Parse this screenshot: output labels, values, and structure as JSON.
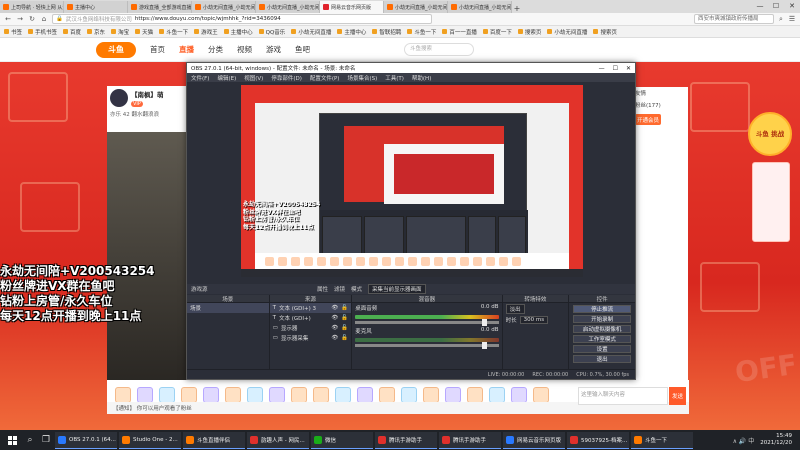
{
  "browser": {
    "tabs": [
      {
        "label": "上司导航 · 轻快上网 从这里开始",
        "active": false,
        "fav": "orange"
      },
      {
        "label": "主播中心",
        "active": false,
        "fav": "orange"
      },
      {
        "label": "游戏直播_全部游戏直播_斗鱼直播",
        "active": false,
        "fav": "orange"
      },
      {
        "label": "小劫无间直播_小劫无间视频直播",
        "active": false,
        "fav": "orange"
      },
      {
        "label": "小劫无间直播_小劫无间视频直播",
        "active": false,
        "fav": "orange"
      },
      {
        "label": "网易云音乐网页版",
        "active": true,
        "fav": "red"
      },
      {
        "label": "小劫无间直播_小劫无间直播间",
        "active": false,
        "fav": "orange"
      },
      {
        "label": "小劫无间直播_小劫无间直播间",
        "active": false,
        "fav": "orange"
      }
    ],
    "new_tab": "+",
    "url_secure": "武汉斗鱼网络科技有限公司",
    "url": "https://www.douyu.com/topic/wjmhhk_?rid=3436094",
    "search_placeholder": "西安市爽城镇政府传播局",
    "bookmarks": [
      "书签",
      "手机书签",
      "百度",
      "京东",
      "淘宝",
      "天猫",
      "斗鱼一下",
      "游戏王",
      "主播中心",
      "QQ音乐",
      "小劫无间直播",
      "主播中心",
      "智联招聘",
      "斗鱼一下",
      "百一一直播",
      "百度一下",
      "搜索页",
      "小劫无间直播",
      "搜索页"
    ]
  },
  "douyu": {
    "logo": "斗鱼",
    "nav": [
      "首页",
      "直播",
      "分类",
      "视频",
      "游戏",
      "鱼吧"
    ],
    "active_nav": "直播",
    "search_placeholder": "斗鱼搜索",
    "streamer_name": "【南枫】萌",
    "streamer_badge": "VIP",
    "stats": "亦乐 42   翻水翻浪浪",
    "right_panel_lines": [
      "友情",
      "粉丝(177)"
    ],
    "follow_btn": "开通会员",
    "chat_placeholder": "这里输入聊天内容",
    "send_btn": "发送",
    "side_badge": "斗鱼\n挑战",
    "watermark": "OFF",
    "chat_hint": "【通知】 你可以用户观看了粉丝"
  },
  "overlay": {
    "lines": "永劫无间陪+V200543254\n粉丝牌进VX群在鱼吧\n钻粉上房管/永久车位\n每天12点开播到晚上11点"
  },
  "obs": {
    "title": "OBS 27.0.1 (64-bit, windows) - 配置文件: 未命名 - 场景: 未命名",
    "window_controls": [
      "—",
      "☐",
      "✕"
    ],
    "menu": [
      "文件(F)",
      "编辑(E)",
      "视图(V)",
      "停靠部件(D)",
      "配置文件(P)",
      "场景集合(S)",
      "工具(T)",
      "帮助(H)"
    ],
    "bar_scene": "游戏源",
    "bar_items": [
      "属性",
      "滤镜",
      "模式",
      "采集当前显示器画面"
    ],
    "docks": {
      "scenes": {
        "title": "场景",
        "items": [
          "场景"
        ]
      },
      "sources": {
        "title": "来源",
        "items": [
          "文本 (GDI+) 3",
          "文本 (GDI+)",
          "显示器",
          "显示器采集"
        ]
      },
      "mixer": {
        "title": "混音器",
        "channels": [
          {
            "name": "桌面音频",
            "db": "0.0 dB"
          },
          {
            "name": "麦克风",
            "db": "0.0 dB"
          }
        ]
      },
      "transitions": {
        "title": "转场特效",
        "type": "淡出",
        "duration_label": "时长",
        "duration": "300 ms"
      },
      "controls": {
        "title": "控件",
        "buttons": [
          "停止推流",
          "开始录制",
          "启动虚拟摄像机",
          "工作室模式",
          "设置",
          "退出"
        ]
      }
    },
    "status": [
      "LIVE: 00:00:00",
      "REC: 00:00:00",
      "CPU: 0.7%, 30.00 fps"
    ],
    "dock_foot": "+ —  ⚙  ∧ ∨"
  },
  "taskbar": {
    "apps": [
      {
        "label": "OBS 27.0.1 (64...",
        "color": "blue"
      },
      {
        "label": "Studio One - 2...",
        "color": "orange"
      },
      {
        "label": "斗鱼直播伴侣",
        "color": "orange"
      },
      {
        "label": "韵趣人声 - 网民...",
        "color": "red"
      },
      {
        "label": "微信",
        "color": "green"
      },
      {
        "label": "腾讯手游助手",
        "color": "red"
      },
      {
        "label": "腾讯手游助手",
        "color": "red"
      },
      {
        "label": "网易云音乐网页版",
        "color": "blue"
      },
      {
        "label": "59037925-档案...",
        "color": "red"
      },
      {
        "label": "斗鱼一下",
        "color": "orange"
      }
    ],
    "time": "15:49",
    "date": "2021/12/20"
  }
}
